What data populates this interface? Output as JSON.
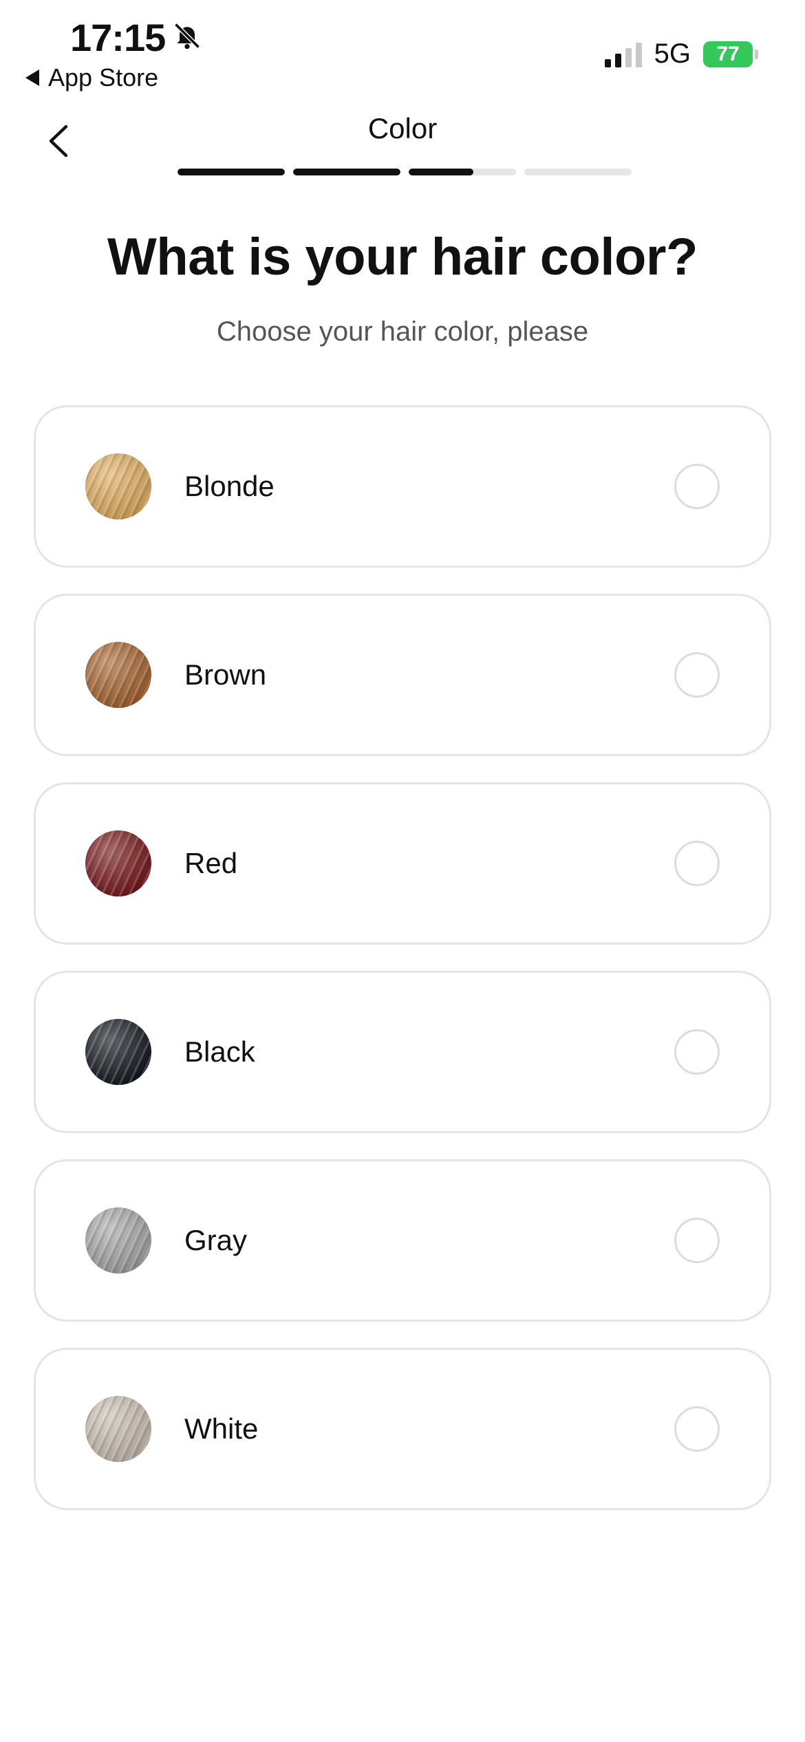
{
  "status_bar": {
    "time": "17:15",
    "back_app": "App Store",
    "network": "5G",
    "battery": "77"
  },
  "header": {
    "title": "Color",
    "progress": {
      "total_steps": 4,
      "completed_steps": 2,
      "current_step_fraction": 0.6
    }
  },
  "main": {
    "heading": "What is your hair color?",
    "subheading": "Choose your hair color, please",
    "options": [
      {
        "label": "Blonde",
        "color": "#e2ae5e"
      },
      {
        "label": "Brown",
        "color": "#a9652f"
      },
      {
        "label": "Red",
        "color": "#7a1a1c"
      },
      {
        "label": "Black",
        "color": "#151a20"
      },
      {
        "label": "Gray",
        "color": "#a7a7a7"
      },
      {
        "label": "White",
        "color": "#cbbfb2"
      }
    ]
  }
}
